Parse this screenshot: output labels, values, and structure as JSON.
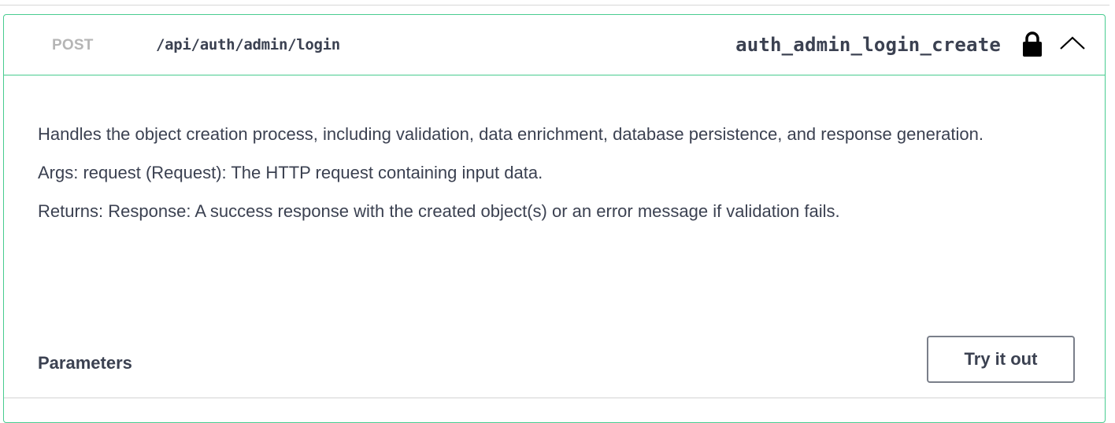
{
  "operation": {
    "method": "POST",
    "path": "/api/auth/admin/login",
    "operation_id": "auth_admin_login_create",
    "lock_icon": "lock-icon",
    "collapse_icon": "chevron-up-icon",
    "accent_color": "#49cc90"
  },
  "description": {
    "summary": "Handles the object creation process, including validation, data enrichment, database persistence, and response generation.",
    "args": "Args: request (Request): The HTTP request containing input data.",
    "returns": "Returns: Response: A success response with the created object(s) or an error message if validation fails."
  },
  "parameters": {
    "title": "Parameters",
    "try_button_label": "Try it out"
  }
}
